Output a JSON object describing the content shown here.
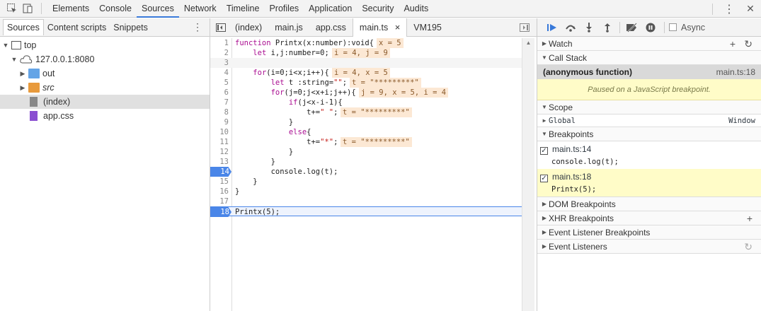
{
  "topbar": {
    "tabs": [
      "Elements",
      "Console",
      "Sources",
      "Network",
      "Timeline",
      "Profiles",
      "Application",
      "Security",
      "Audits"
    ],
    "active_tab": "Sources",
    "kebab": "⋮",
    "close": "✕"
  },
  "navigator": {
    "tabs": [
      "Sources",
      "Content scripts",
      "Snippets"
    ],
    "active_tab": "Sources",
    "tree": {
      "top": "top",
      "host": "127.0.0.1:8080",
      "out": "out",
      "src": "src",
      "index": "(index)",
      "appcss": "app.css"
    }
  },
  "editor": {
    "tabs": [
      "(index)",
      "main.js",
      "app.css",
      "main.ts",
      "VM195"
    ],
    "active_tab": "main.ts",
    "close_glyph": "×",
    "lines": [
      {
        "n": "1",
        "code": "function Printx(x:number):void{",
        "inline": "x = 5"
      },
      {
        "n": "2",
        "code": "    let i,j:number=0;",
        "inline": "i = 4, j = 9"
      },
      {
        "n": "3",
        "code": "",
        "inline": ""
      },
      {
        "n": "4",
        "code": "    for(i=0;i<x;i++){",
        "inline": "i = 4, x = 5"
      },
      {
        "n": "5",
        "code": "        let t :string=\"\";",
        "inline": "t = \"*********\""
      },
      {
        "n": "6",
        "code": "        for(j=0;j<x+i;j++){",
        "inline": "j = 9, x = 5, i = 4"
      },
      {
        "n": "7",
        "code": "            if(j<x-i-1){",
        "inline": ""
      },
      {
        "n": "8",
        "code": "                t+=\" \";",
        "inline": "t = \"*********\""
      },
      {
        "n": "9",
        "code": "            }",
        "inline": ""
      },
      {
        "n": "10",
        "code": "            else{",
        "inline": ""
      },
      {
        "n": "11",
        "code": "                t+=\"*\";",
        "inline": "t = \"*********\""
      },
      {
        "n": "12",
        "code": "            }",
        "inline": ""
      },
      {
        "n": "13",
        "code": "        }",
        "inline": ""
      },
      {
        "n": "14",
        "code": "        console.log(t);",
        "inline": ""
      },
      {
        "n": "15",
        "code": "    }",
        "inline": ""
      },
      {
        "n": "16",
        "code": "}",
        "inline": ""
      },
      {
        "n": "17",
        "code": "",
        "inline": ""
      },
      {
        "n": "18",
        "code": "Printx(5);",
        "inline": ""
      }
    ],
    "breakpoint_lines": [
      "14",
      "18"
    ],
    "current_line": "18"
  },
  "debugger": {
    "async_label": "Async",
    "watch": "Watch",
    "call_stack": "Call Stack",
    "frame_name": "(anonymous function)",
    "frame_loc": "main.ts:18",
    "paused_msg": "Paused on a JavaScript breakpoint.",
    "scope": "Scope",
    "scope_global": "Global",
    "scope_global_val": "Window",
    "breakpoints": "Breakpoints",
    "bp1_loc": "main.ts:14",
    "bp1_code": "console.log(t);",
    "bp2_loc": "main.ts:18",
    "bp2_code": "Printx(5);",
    "dom_bp": "DOM Breakpoints",
    "xhr_bp": "XHR Breakpoints",
    "event_bp": "Event Listener Breakpoints",
    "event_listeners": "Event Listeners"
  }
}
